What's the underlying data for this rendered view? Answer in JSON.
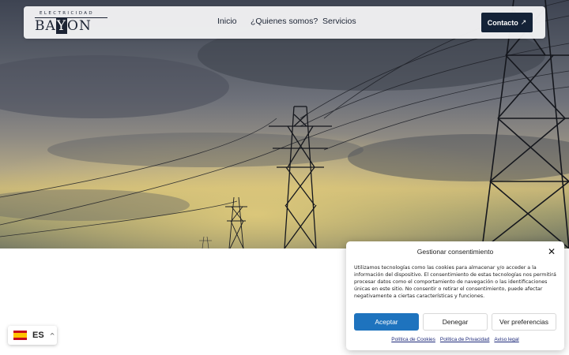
{
  "header": {
    "logo_top": "ELECTRICIDAD",
    "logo_b": "BA",
    "logo_y": "Y",
    "logo_end": "ON",
    "nav": [
      {
        "label": "Inicio"
      },
      {
        "label": "¿Quienes somos?"
      },
      {
        "label": "Servicios"
      }
    ],
    "contact_label": "Contacto",
    "contact_icon": "↗"
  },
  "language": {
    "code": "ES",
    "flag": "spain-flag-icon",
    "chevron": "^"
  },
  "consent": {
    "title": "Gestionar consentimiento",
    "close": "✕",
    "text": "Utilizamos tecnologías como las cookies para almacenar y/o acceder a la información del dispositivo. El consentimiento de estas tecnologías nos permitirá procesar datos como el comportamiento de navegación o las identificaciones únicas en este sitio. No consentir o retirar el consentimiento, puede afectar negativamente a ciertas características y funciones.",
    "accept": "Aceptar",
    "deny": "Denegar",
    "prefs": "Ver preferencias",
    "links": [
      "Política de Cookies",
      "Política de Privacidad",
      "Aviso legal"
    ]
  },
  "colors": {
    "brand_dark": "#142237",
    "accept_blue": "#1e73be"
  }
}
